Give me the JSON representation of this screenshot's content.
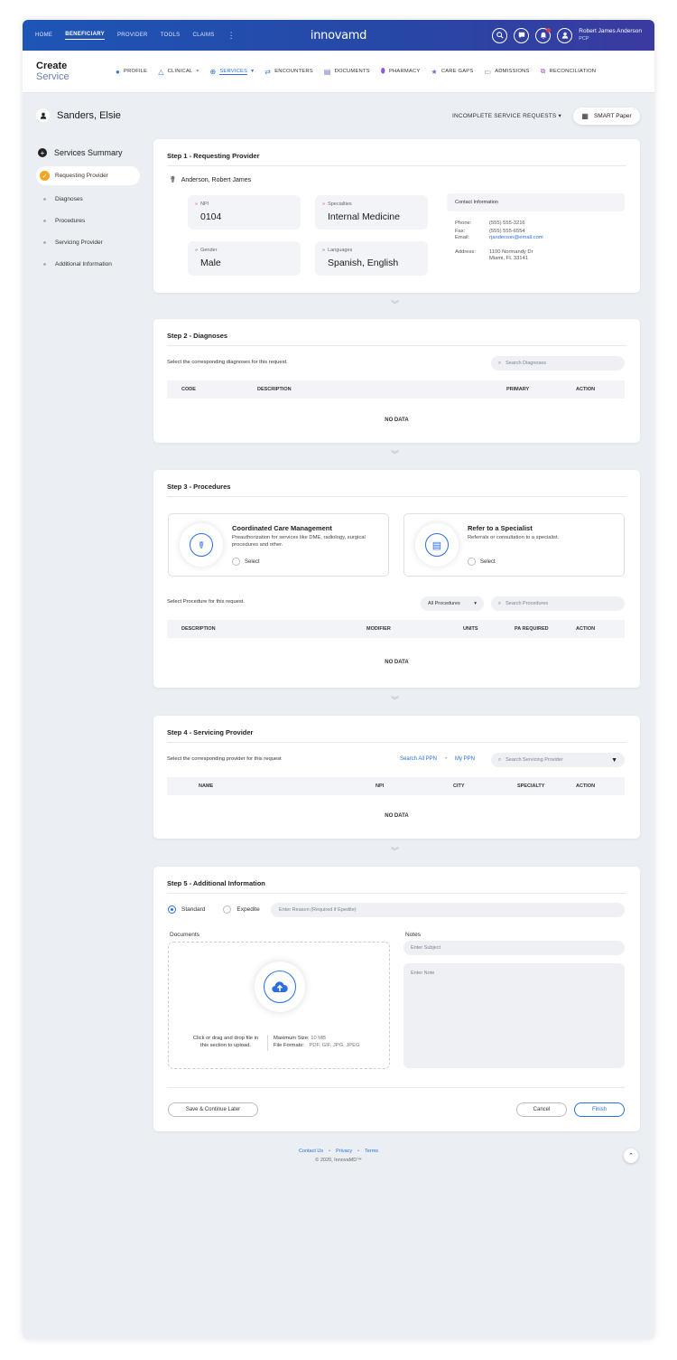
{
  "topnav": {
    "items": [
      "HOME",
      "BENEFICIARY",
      "PROVIDER",
      "TOOLS",
      "CLAIMS"
    ],
    "more": "⋮"
  },
  "logo": "innovamd",
  "user": {
    "name": "Robert James Anderson",
    "role": "PCP"
  },
  "page_title": {
    "line1": "Create",
    "line2": "Service"
  },
  "tabs": [
    "PROFILE",
    "CLINICAL",
    "SERVICES",
    "ENCOUNTERS",
    "DOCUMENTS",
    "PHARMACY",
    "CARE GAPS",
    "ADMISSIONS",
    "RECONCILIATION"
  ],
  "patient": {
    "name": "Sanders, Elsie"
  },
  "incomplete_label": "INCOMPLETE SERVICE REQUESTS",
  "smart_paper": "SMART Paper",
  "sidebar": {
    "title": "Services Summary",
    "items": [
      "Requesting Provider",
      "Diagnoses",
      "Procedures",
      "Servicing Provider",
      "Additional Information"
    ]
  },
  "step1": {
    "title": "Step 1 - Requesting Provider",
    "provider_name": "Anderson, Robert James",
    "npi_label": "NPI",
    "npi": "0104",
    "specialties_label": "Specialties",
    "specialties": "Internal Medicine",
    "gender_label": "Gender",
    "gender": "Male",
    "languages_label": "Languages",
    "languages": "Spanish, English",
    "contact": {
      "title": "Contact Information",
      "phone_label": "Phone:",
      "phone": "(555) 555-3216",
      "fax_label": "Fax:",
      "fax": "(555) 555-6554",
      "email_label": "Email:",
      "email": "rjanderson@email.com",
      "address_label": "Address:",
      "address1": "1100 Normandy Dr",
      "address2": "Miami, FL 33141"
    }
  },
  "step2": {
    "title": "Step 2 - Diagnoses",
    "hint": "Select the corresponding diagnoses for this request.",
    "search_placeholder": "Search Diagnoses",
    "columns": [
      "CODE",
      "DESCRIPTION",
      "PRIMARY",
      "ACTION"
    ],
    "empty": "NO DATA"
  },
  "step3": {
    "title": "Step 3 - Procedures",
    "option1": {
      "title": "Coordinated Care Management",
      "desc": "Preauthorization for services like DME, radiology, surgical procedures and other.",
      "select": "Select"
    },
    "option2": {
      "title": "Refer to a Specialist",
      "desc": "Referrals or consultation to a specialist.",
      "select": "Select"
    },
    "hint": "Select Procedure for this request.",
    "filter": "All Procedures",
    "search_placeholder": "Search Procedures",
    "columns": [
      "DESCRIPTION",
      "MODIFIER",
      "UNITS",
      "PA REQUIRED",
      "ACTION"
    ],
    "empty": "NO DATA"
  },
  "step4": {
    "title": "Step 4 - Servicing Provider",
    "hint": "Select the corresponding provider for this request",
    "link_all": "Search All PPN",
    "link_my": "My PPN",
    "search_placeholder": "Search Servicing Provider",
    "columns": [
      "NAME",
      "NPI",
      "CITY",
      "SPECIALTY",
      "ACTION"
    ],
    "empty": "NO DATA"
  },
  "step5": {
    "title": "Step 5 - Additional Information",
    "standard": "Standard",
    "expedite": "Expedite",
    "reason_placeholder": "Enter Reason (Required if Epedite)",
    "documents_label": "Documents",
    "notes_label": "Notes",
    "drop_text": "Click or drag and drop file in this section to upload.",
    "max_size_label": "Maximum Size:",
    "max_size": "10 MB",
    "formats_label": "File Formats:",
    "formats": "PDF, GIF, JPG, JPEG",
    "subject_placeholder": "Enter Subject",
    "note_placeholder": "Enter Note",
    "save_later": "Save & Continue Later",
    "cancel": "Cancel",
    "finish": "Finish"
  },
  "footer": {
    "contact": "Contact Us",
    "privacy": "Privacy",
    "terms": "Terms",
    "copyright": "© 2020, InnovaMD™"
  },
  "colors": {
    "primary": "#2a6ee0",
    "header_start": "#1e55b6",
    "header_end": "#3b3aa0",
    "check": "#f4a623",
    "background": "#ebeef3"
  }
}
